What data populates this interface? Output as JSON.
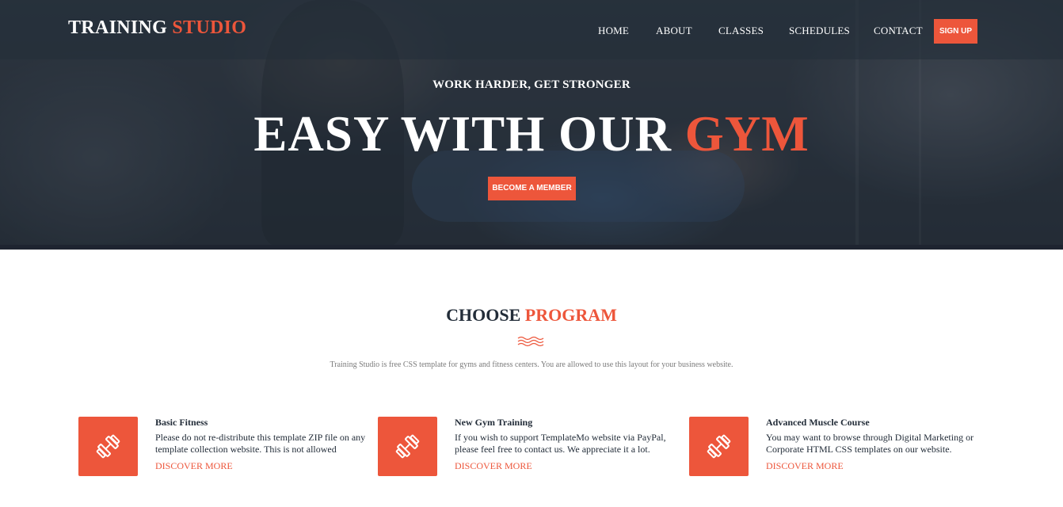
{
  "header": {
    "logo_main": "TRAINING",
    "logo_accent": "STUDIO",
    "nav": [
      "HOME",
      "ABOUT",
      "CLASSES",
      "SCHEDULES",
      "CONTACT"
    ],
    "signup_label": "SIGN UP"
  },
  "hero": {
    "subtitle": "WORK HARDER, GET STRONGER",
    "title_main": "EASY WITH OUR",
    "title_accent": "GYM",
    "cta_label": "BECOME A MEMBER"
  },
  "programs": {
    "title_main": "CHOOSE",
    "title_accent": "PROGRAM",
    "description": "Training Studio is free CSS template for gyms and fitness centers. You are allowed to use this layout for your business website.",
    "items": [
      {
        "icon": "dumbbell-icon",
        "title": "Basic Fitness",
        "text": "Please do not re-distribute this template ZIP file on any template collection website. This is not allowed",
        "link": "DISCOVER MORE"
      },
      {
        "icon": "dumbbell-icon",
        "title": "New Gym Training",
        "text": "If you wish to support TemplateMo website via PayPal, please feel free to contact us. We appreciate it a lot.",
        "link": "DISCOVER MORE"
      },
      {
        "icon": "dumbbell-icon",
        "title": "Advanced Muscle Course",
        "text": "You may want to browse through Digital Marketing or Corporate HTML CSS templates on our website.",
        "link": "DISCOVER MORE"
      }
    ]
  },
  "colors": {
    "accent": "#ed563b",
    "dark": "#232d39"
  }
}
